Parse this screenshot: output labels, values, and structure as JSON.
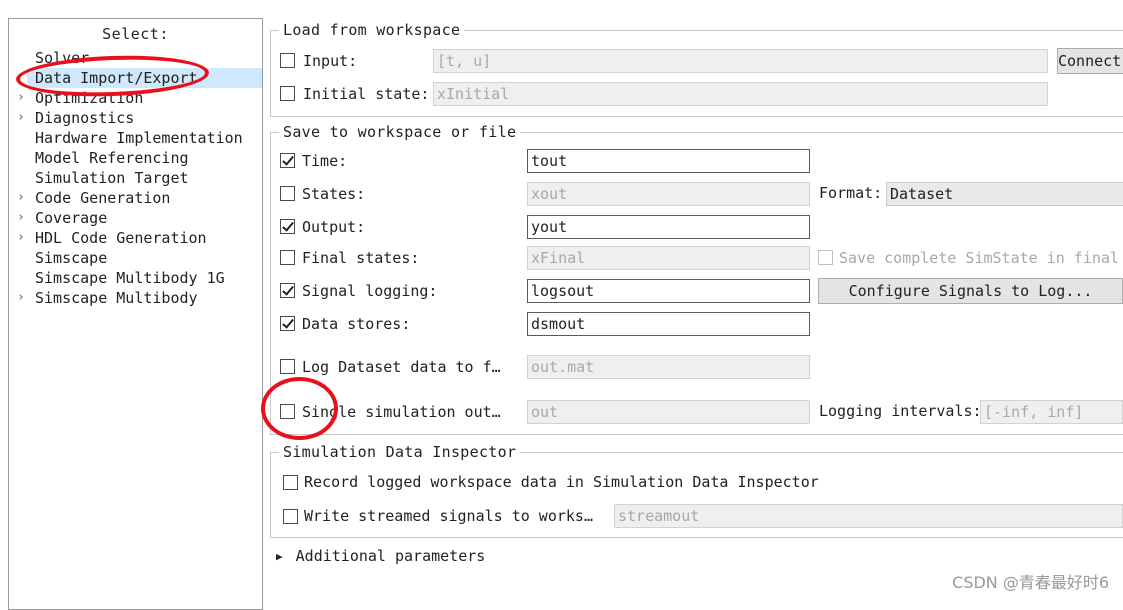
{
  "tree": {
    "title": "Select:",
    "items": [
      {
        "label": "Solver",
        "expandable": false
      },
      {
        "label": "Data Import/Export",
        "expandable": false,
        "selected": true
      },
      {
        "label": "Optimization",
        "expandable": true
      },
      {
        "label": "Diagnostics",
        "expandable": true
      },
      {
        "label": "Hardware Implementation",
        "expandable": false
      },
      {
        "label": "Model Referencing",
        "expandable": false
      },
      {
        "label": "Simulation Target",
        "expandable": false
      },
      {
        "label": "Code Generation",
        "expandable": true
      },
      {
        "label": "Coverage",
        "expandable": true
      },
      {
        "label": "HDL Code Generation",
        "expandable": true
      },
      {
        "label": "Simscape",
        "expandable": false
      },
      {
        "label": "Simscape Multibody 1G",
        "expandable": false
      },
      {
        "label": "Simscape Multibody",
        "expandable": true
      }
    ]
  },
  "load": {
    "title": "Load from workspace",
    "input": {
      "label": "Input:",
      "checked": false,
      "value": "[t, u]",
      "button": "Connect Input"
    },
    "initial_state": {
      "label": "Initial state:",
      "checked": false,
      "value": "xInitial"
    }
  },
  "save": {
    "title": "Save to workspace or file",
    "time": {
      "label": "Time:",
      "checked": true,
      "value": "tout"
    },
    "states": {
      "label": "States:",
      "checked": false,
      "value": "xout"
    },
    "format": {
      "label": "Format:",
      "value": "Dataset"
    },
    "output": {
      "label": "Output:",
      "checked": true,
      "value": "yout"
    },
    "final_states": {
      "label": "Final states:",
      "checked": false,
      "value": "xFinal"
    },
    "save_simstate": {
      "label": "Save complete SimState in final state",
      "checked": false
    },
    "signal_logging": {
      "label": "Signal logging:",
      "checked": true,
      "value": "logsout"
    },
    "configure_signals": "Configure Signals to Log...",
    "data_stores": {
      "label": "Data stores:",
      "checked": true,
      "value": "dsmout"
    },
    "log_dataset": {
      "label": "Log Dataset data to f…",
      "checked": false,
      "value": "out.mat"
    },
    "single_output": {
      "label": "Single simulation out…",
      "checked": false,
      "value": "out"
    },
    "logging_intervals": {
      "label": "Logging intervals:",
      "value": "[-inf, inf]"
    }
  },
  "sdi": {
    "title": "Simulation Data Inspector",
    "record": {
      "label": "Record logged workspace data in Simulation Data Inspector",
      "checked": false
    },
    "write_streamed": {
      "label": "Write streamed signals to works…",
      "checked": false,
      "value": "streamout"
    }
  },
  "additional": {
    "label": "Additional parameters"
  },
  "watermark": "CSDN @青春最好时6",
  "colors": {
    "annotation": "#e8101c",
    "selection": "#cfe8fc"
  }
}
